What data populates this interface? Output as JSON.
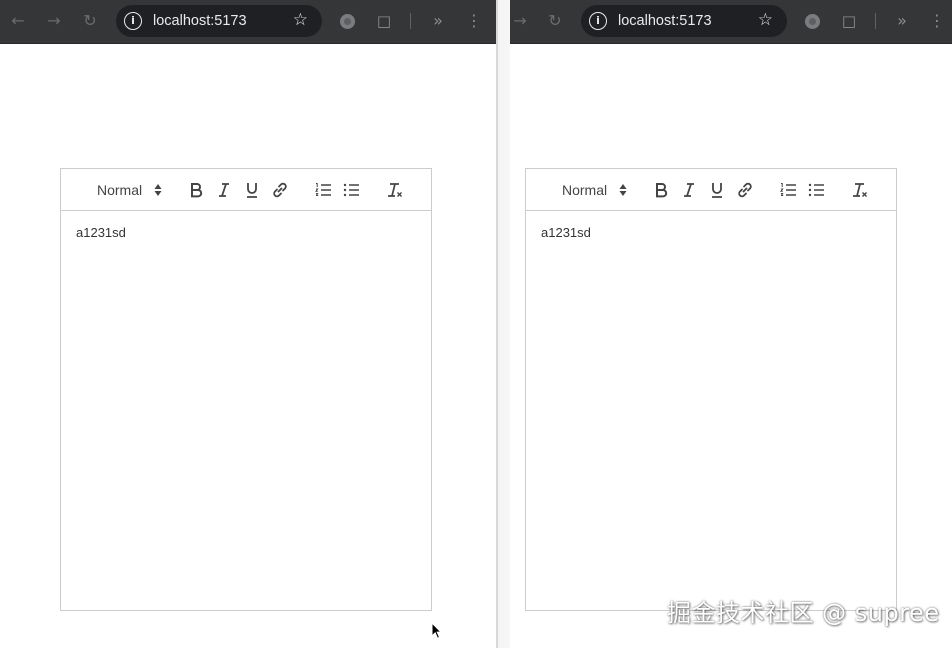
{
  "browser_left": {
    "nav_back_icon": "back-arrow-icon",
    "nav_forward_icon": "forward-arrow-icon",
    "reload_icon": "reload-icon",
    "url": "localhost:5173"
  },
  "browser_right": {
    "nav_forward_icon": "forward-arrow-icon",
    "reload_icon": "reload-icon",
    "url": "localhost:5173"
  },
  "editor_left": {
    "header_select": "Normal",
    "content": "a1231sd"
  },
  "editor_right": {
    "header_select": "Normal",
    "content": "a1231sd"
  },
  "toolbar_icons": [
    "bold-icon",
    "italic-icon",
    "underline-icon",
    "link-icon",
    "ordered-list-icon",
    "bullet-list-icon",
    "clear-format-icon"
  ],
  "colors": {
    "browser_toolbar": "#353638",
    "omnibox": "#1f2023",
    "editor_border": "#cccccc",
    "editor_icon": "#444444"
  },
  "watermark": "掘金技术社区 @ supree"
}
